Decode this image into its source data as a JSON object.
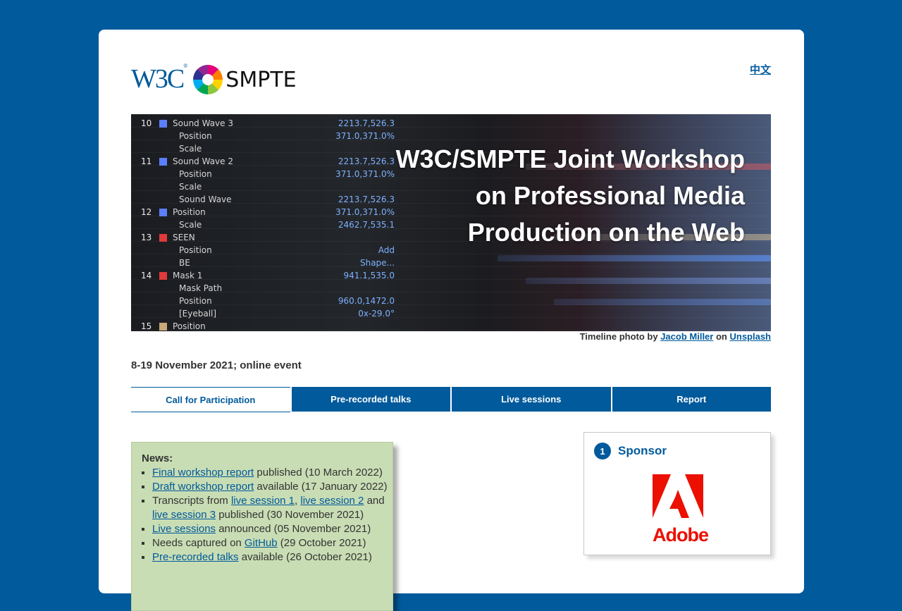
{
  "header": {
    "w3c_logo": "W3C",
    "w3c_reg": "®",
    "smpte_logo": "SMPTE",
    "lang_link": "中文"
  },
  "hero": {
    "title_line1": "W3C/SMPTE Joint Workshop",
    "title_line2": "on Professional Media",
    "title_line3": "Production on the Web",
    "timeline_rows": [
      {
        "num": "10",
        "label": "Sound Wave 3",
        "val": "2213.7,526.3"
      },
      {
        "num": "",
        "label": "Position",
        "val": "371.0,371.0%"
      },
      {
        "num": "",
        "label": "Scale",
        "val": ""
      },
      {
        "num": "11",
        "label": "Sound Wave 2",
        "val": "2213.7,526.3"
      },
      {
        "num": "",
        "label": "Position",
        "val": "371.0,371.0%"
      },
      {
        "num": "",
        "label": "Scale",
        "val": ""
      },
      {
        "num": "",
        "label": "Sound Wave",
        "val": "2213.7,526.3"
      },
      {
        "num": "12",
        "label": "Position",
        "val": "371.0,371.0%"
      },
      {
        "num": "",
        "label": "Scale",
        "val": "2462.7,535.1"
      },
      {
        "num": "13",
        "label": "SEEN",
        "val": ""
      },
      {
        "num": "",
        "label": "Position",
        "val": "Add"
      },
      {
        "num": "",
        "label": "BE",
        "val": "Shape..."
      },
      {
        "num": "14",
        "label": "Mask 1",
        "val": "941.1,535.0"
      },
      {
        "num": "",
        "label": "Mask Path",
        "val": ""
      },
      {
        "num": "",
        "label": "Position",
        "val": "960.0,1472.0"
      },
      {
        "num": "",
        "label": "[Eyeball]",
        "val": "0x-29.0°"
      },
      {
        "num": "15",
        "label": "Position",
        "val": ""
      }
    ],
    "credit_prefix": "Timeline photo by",
    "credit_author": "Jacob Miller",
    "credit_mid": "on",
    "credit_site": "Unsplash"
  },
  "event_date": "8-19 November 2021; online event",
  "tabs": [
    {
      "label": "Call for Participation",
      "active": true
    },
    {
      "label": "Pre-recorded talks",
      "active": false
    },
    {
      "label": "Live sessions",
      "active": false
    },
    {
      "label": "Report",
      "active": false
    }
  ],
  "news": {
    "heading": "News:",
    "items": {
      "i1_link": "Final workshop report",
      "i1_text": " published (10 March 2022)",
      "i2_link": "Draft workshop report",
      "i2_text": " available (17 January 2022)",
      "i3_text_a": "Transcripts from ",
      "i3_link1": "live session 1",
      "i3_sep": ", ",
      "i3_link2": "live session 2",
      "i3_and": " and ",
      "i3_link3": "live session 3",
      "i3_text_b": " published (30 November 2021)",
      "i4_link": "Live sessions",
      "i4_text": " announced (05 November 2021)",
      "i5_text_a": "Needs captured on ",
      "i5_link": "GitHub",
      "i5_text_b": " (29 October 2021)",
      "i6_link": "Pre-recorded talks",
      "i6_text": " available (26 October 2021)"
    }
  },
  "sponsor": {
    "badge": "1",
    "title": "Sponsor",
    "name": "Adobe"
  },
  "colors": {
    "page_bg": "#005a9c",
    "accent": "#005a9c",
    "news_bg": "#c9ddb4",
    "adobe_red": "#eb1000"
  }
}
